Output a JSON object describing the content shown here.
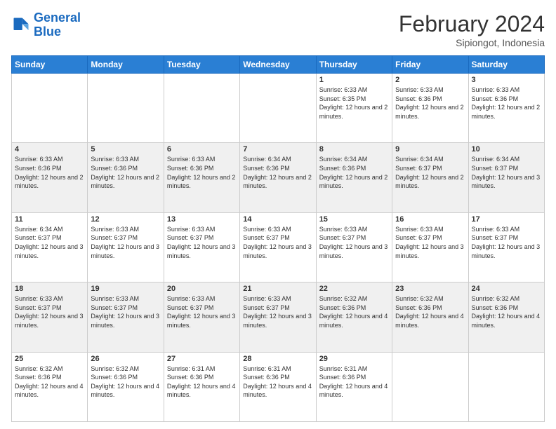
{
  "logo": {
    "line1": "General",
    "line2": "Blue"
  },
  "header": {
    "month": "February 2024",
    "location": "Sipiongot, Indonesia"
  },
  "weekdays": [
    "Sunday",
    "Monday",
    "Tuesday",
    "Wednesday",
    "Thursday",
    "Friday",
    "Saturday"
  ],
  "weeks": [
    [
      {
        "day": "",
        "sunrise": "",
        "sunset": "",
        "daylight": ""
      },
      {
        "day": "",
        "sunrise": "",
        "sunset": "",
        "daylight": ""
      },
      {
        "day": "",
        "sunrise": "",
        "sunset": "",
        "daylight": ""
      },
      {
        "day": "",
        "sunrise": "",
        "sunset": "",
        "daylight": ""
      },
      {
        "day": "1",
        "sunrise": "Sunrise: 6:33 AM",
        "sunset": "Sunset: 6:35 PM",
        "daylight": "Daylight: 12 hours and 2 minutes."
      },
      {
        "day": "2",
        "sunrise": "Sunrise: 6:33 AM",
        "sunset": "Sunset: 6:36 PM",
        "daylight": "Daylight: 12 hours and 2 minutes."
      },
      {
        "day": "3",
        "sunrise": "Sunrise: 6:33 AM",
        "sunset": "Sunset: 6:36 PM",
        "daylight": "Daylight: 12 hours and 2 minutes."
      }
    ],
    [
      {
        "day": "4",
        "sunrise": "Sunrise: 6:33 AM",
        "sunset": "Sunset: 6:36 PM",
        "daylight": "Daylight: 12 hours and 2 minutes."
      },
      {
        "day": "5",
        "sunrise": "Sunrise: 6:33 AM",
        "sunset": "Sunset: 6:36 PM",
        "daylight": "Daylight: 12 hours and 2 minutes."
      },
      {
        "day": "6",
        "sunrise": "Sunrise: 6:33 AM",
        "sunset": "Sunset: 6:36 PM",
        "daylight": "Daylight: 12 hours and 2 minutes."
      },
      {
        "day": "7",
        "sunrise": "Sunrise: 6:34 AM",
        "sunset": "Sunset: 6:36 PM",
        "daylight": "Daylight: 12 hours and 2 minutes."
      },
      {
        "day": "8",
        "sunrise": "Sunrise: 6:34 AM",
        "sunset": "Sunset: 6:36 PM",
        "daylight": "Daylight: 12 hours and 2 minutes."
      },
      {
        "day": "9",
        "sunrise": "Sunrise: 6:34 AM",
        "sunset": "Sunset: 6:37 PM",
        "daylight": "Daylight: 12 hours and 2 minutes."
      },
      {
        "day": "10",
        "sunrise": "Sunrise: 6:34 AM",
        "sunset": "Sunset: 6:37 PM",
        "daylight": "Daylight: 12 hours and 3 minutes."
      }
    ],
    [
      {
        "day": "11",
        "sunrise": "Sunrise: 6:34 AM",
        "sunset": "Sunset: 6:37 PM",
        "daylight": "Daylight: 12 hours and 3 minutes."
      },
      {
        "day": "12",
        "sunrise": "Sunrise: 6:33 AM",
        "sunset": "Sunset: 6:37 PM",
        "daylight": "Daylight: 12 hours and 3 minutes."
      },
      {
        "day": "13",
        "sunrise": "Sunrise: 6:33 AM",
        "sunset": "Sunset: 6:37 PM",
        "daylight": "Daylight: 12 hours and 3 minutes."
      },
      {
        "day": "14",
        "sunrise": "Sunrise: 6:33 AM",
        "sunset": "Sunset: 6:37 PM",
        "daylight": "Daylight: 12 hours and 3 minutes."
      },
      {
        "day": "15",
        "sunrise": "Sunrise: 6:33 AM",
        "sunset": "Sunset: 6:37 PM",
        "daylight": "Daylight: 12 hours and 3 minutes."
      },
      {
        "day": "16",
        "sunrise": "Sunrise: 6:33 AM",
        "sunset": "Sunset: 6:37 PM",
        "daylight": "Daylight: 12 hours and 3 minutes."
      },
      {
        "day": "17",
        "sunrise": "Sunrise: 6:33 AM",
        "sunset": "Sunset: 6:37 PM",
        "daylight": "Daylight: 12 hours and 3 minutes."
      }
    ],
    [
      {
        "day": "18",
        "sunrise": "Sunrise: 6:33 AM",
        "sunset": "Sunset: 6:37 PM",
        "daylight": "Daylight: 12 hours and 3 minutes."
      },
      {
        "day": "19",
        "sunrise": "Sunrise: 6:33 AM",
        "sunset": "Sunset: 6:37 PM",
        "daylight": "Daylight: 12 hours and 3 minutes."
      },
      {
        "day": "20",
        "sunrise": "Sunrise: 6:33 AM",
        "sunset": "Sunset: 6:37 PM",
        "daylight": "Daylight: 12 hours and 3 minutes."
      },
      {
        "day": "21",
        "sunrise": "Sunrise: 6:33 AM",
        "sunset": "Sunset: 6:37 PM",
        "daylight": "Daylight: 12 hours and 3 minutes."
      },
      {
        "day": "22",
        "sunrise": "Sunrise: 6:32 AM",
        "sunset": "Sunset: 6:36 PM",
        "daylight": "Daylight: 12 hours and 4 minutes."
      },
      {
        "day": "23",
        "sunrise": "Sunrise: 6:32 AM",
        "sunset": "Sunset: 6:36 PM",
        "daylight": "Daylight: 12 hours and 4 minutes."
      },
      {
        "day": "24",
        "sunrise": "Sunrise: 6:32 AM",
        "sunset": "Sunset: 6:36 PM",
        "daylight": "Daylight: 12 hours and 4 minutes."
      }
    ],
    [
      {
        "day": "25",
        "sunrise": "Sunrise: 6:32 AM",
        "sunset": "Sunset: 6:36 PM",
        "daylight": "Daylight: 12 hours and 4 minutes."
      },
      {
        "day": "26",
        "sunrise": "Sunrise: 6:32 AM",
        "sunset": "Sunset: 6:36 PM",
        "daylight": "Daylight: 12 hours and 4 minutes."
      },
      {
        "day": "27",
        "sunrise": "Sunrise: 6:31 AM",
        "sunset": "Sunset: 6:36 PM",
        "daylight": "Daylight: 12 hours and 4 minutes."
      },
      {
        "day": "28",
        "sunrise": "Sunrise: 6:31 AM",
        "sunset": "Sunset: 6:36 PM",
        "daylight": "Daylight: 12 hours and 4 minutes."
      },
      {
        "day": "29",
        "sunrise": "Sunrise: 6:31 AM",
        "sunset": "Sunset: 6:36 PM",
        "daylight": "Daylight: 12 hours and 4 minutes."
      },
      {
        "day": "",
        "sunrise": "",
        "sunset": "",
        "daylight": ""
      },
      {
        "day": "",
        "sunrise": "",
        "sunset": "",
        "daylight": ""
      }
    ]
  ]
}
